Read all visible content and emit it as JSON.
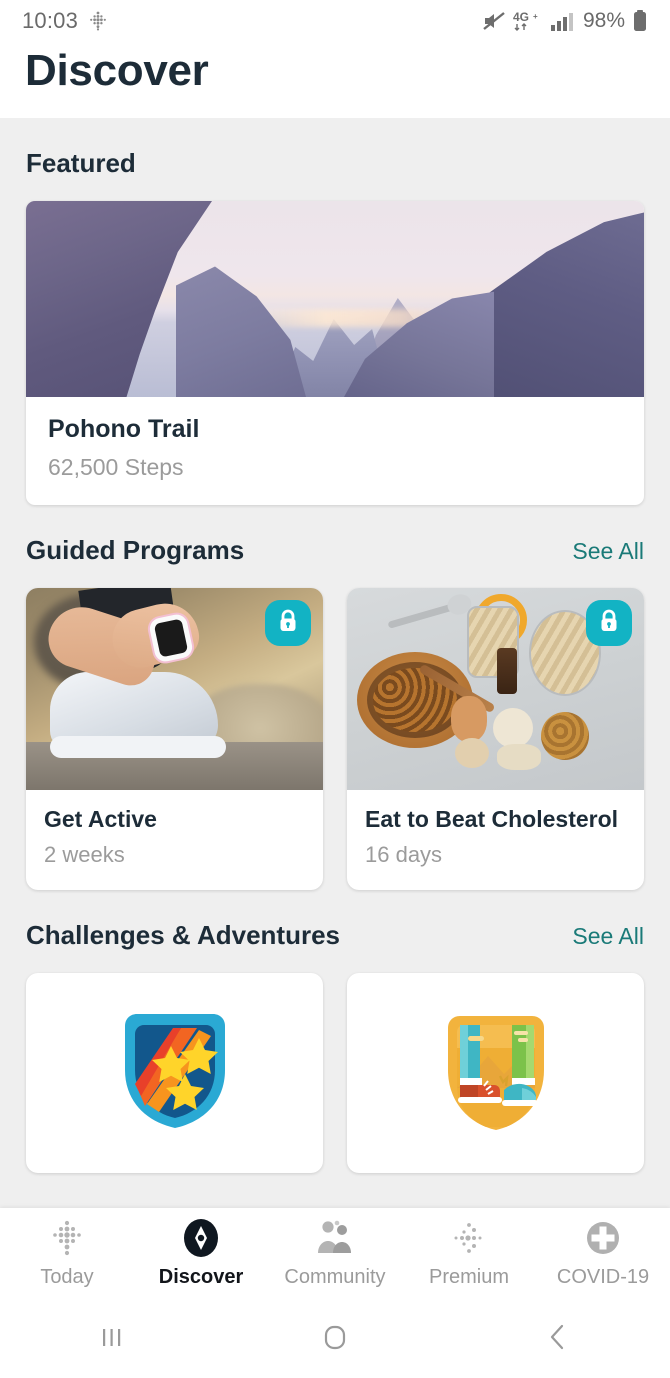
{
  "statusbar": {
    "time": "10:03",
    "app_notification_icon": "fitbit-dots-icon",
    "mute_icon": "mute-icon",
    "network_label": "4G",
    "network_plus": "+",
    "signal_icon": "signal-bars-icon",
    "battery_percent": "98%",
    "battery_icon": "battery-icon"
  },
  "header": {
    "title": "Discover"
  },
  "sections": {
    "featured": {
      "title": "Featured",
      "card": {
        "name": "Pohono Trail",
        "subtitle": "62,500 Steps",
        "image_alt": "yosemite-valley-photo"
      }
    },
    "guided_programs": {
      "title": "Guided Programs",
      "see_all": "See All",
      "cards": [
        {
          "name": "Get Active",
          "subtitle": "2 weeks",
          "locked": true,
          "image_alt": "tying-running-shoe-photo"
        },
        {
          "name": "Eat to Beat Cholesterol",
          "subtitle": "16 days",
          "locked": true,
          "image_alt": "oats-and-nuts-photo"
        }
      ]
    },
    "challenges": {
      "title": "Challenges & Adventures",
      "see_all": "See All",
      "cards": [
        {
          "badge": "stars-shield-badge"
        },
        {
          "badge": "hiking-adventure-badge"
        }
      ]
    }
  },
  "bottom_nav": {
    "items": [
      {
        "label": "Today",
        "icon": "fitbit-dots-icon",
        "active": false
      },
      {
        "label": "Discover",
        "icon": "compass-icon",
        "active": true
      },
      {
        "label": "Community",
        "icon": "people-icon",
        "active": false
      },
      {
        "label": "Premium",
        "icon": "premium-dots-icon",
        "active": false
      },
      {
        "label": "COVID-19",
        "icon": "plus-circle-icon",
        "active": false
      }
    ]
  },
  "android_nav": {
    "recents": "recents-icon",
    "home": "home-icon",
    "back": "back-icon"
  },
  "colors": {
    "accent_teal": "#1a7a78",
    "lock_badge": "#12b3c4",
    "title_navy": "#1d2c38",
    "page_bg": "#efefef",
    "muted_text": "#9b9b9b"
  }
}
